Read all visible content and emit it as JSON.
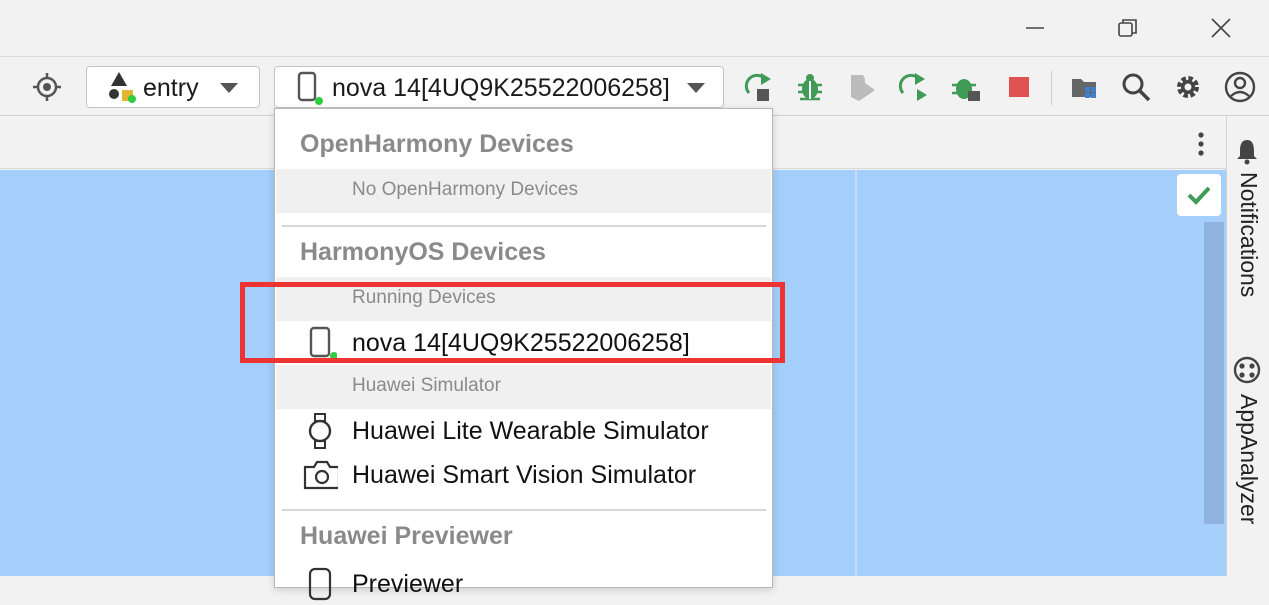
{
  "toolbar": {
    "module_label": "entry",
    "device_label": "nova 14[4UQ9K25522006258]"
  },
  "dropdown": {
    "openharmony_header": "OpenHarmony Devices",
    "openharmony_empty": "No OpenHarmony Devices",
    "harmonyos_header": "HarmonyOS Devices",
    "running_devices_label": "Running Devices",
    "running_device": "nova 14[4UQ9K25522006258]",
    "simulator_label": "Huawei Simulator",
    "simulators": [
      "Huawei Lite Wearable Simulator",
      "Huawei Smart Vision Simulator"
    ],
    "previewer_header": "Huawei Previewer",
    "previewer_partial": "Previewer"
  },
  "sidebar": {
    "notifications": "Notifications",
    "appanalyzer": "AppAnalyzer"
  },
  "colors": {
    "run_green": "#3f9b55",
    "stop_red": "#e05252",
    "highlight": "#ee3333",
    "canvas_blue": "#a4cffb",
    "status_dot": "#2ecc40"
  }
}
